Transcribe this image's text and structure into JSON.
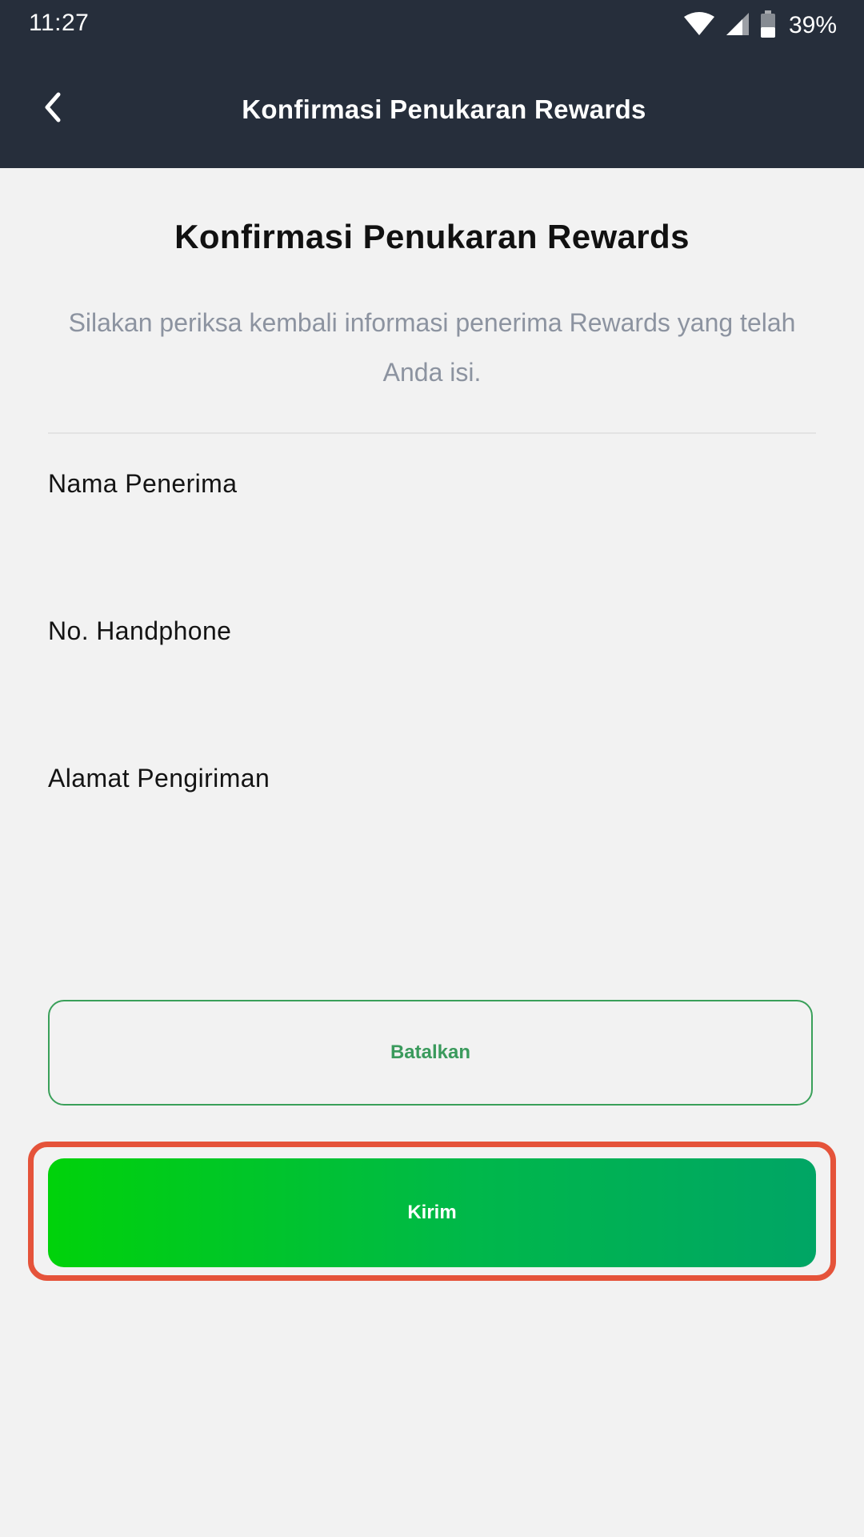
{
  "status_bar": {
    "time": "11:27",
    "battery": "39%",
    "icons": [
      "wifi-icon",
      "signal-icon",
      "battery-icon"
    ]
  },
  "app_bar": {
    "title": "Konfirmasi Penukaran Rewards",
    "back_icon": "chevron-left-icon"
  },
  "content": {
    "title": "Konfirmasi Penukaran Rewards",
    "subtitle": "Silakan periksa kembali informasi penerima Rewards yang telah Anda isi.",
    "fields": {
      "name_label": "Nama Penerima",
      "phone_label": "No. Handphone",
      "address_label": "Alamat Pengiriman"
    }
  },
  "buttons": {
    "cancel_label": "Batalkan",
    "send_label": "Kirim"
  },
  "colors": {
    "header_bg": "#262e3b",
    "page_bg": "#f2f2f2",
    "accent_green": "#00c22e",
    "outline_green": "#3aa05a",
    "highlight_red": "#e5533a"
  }
}
